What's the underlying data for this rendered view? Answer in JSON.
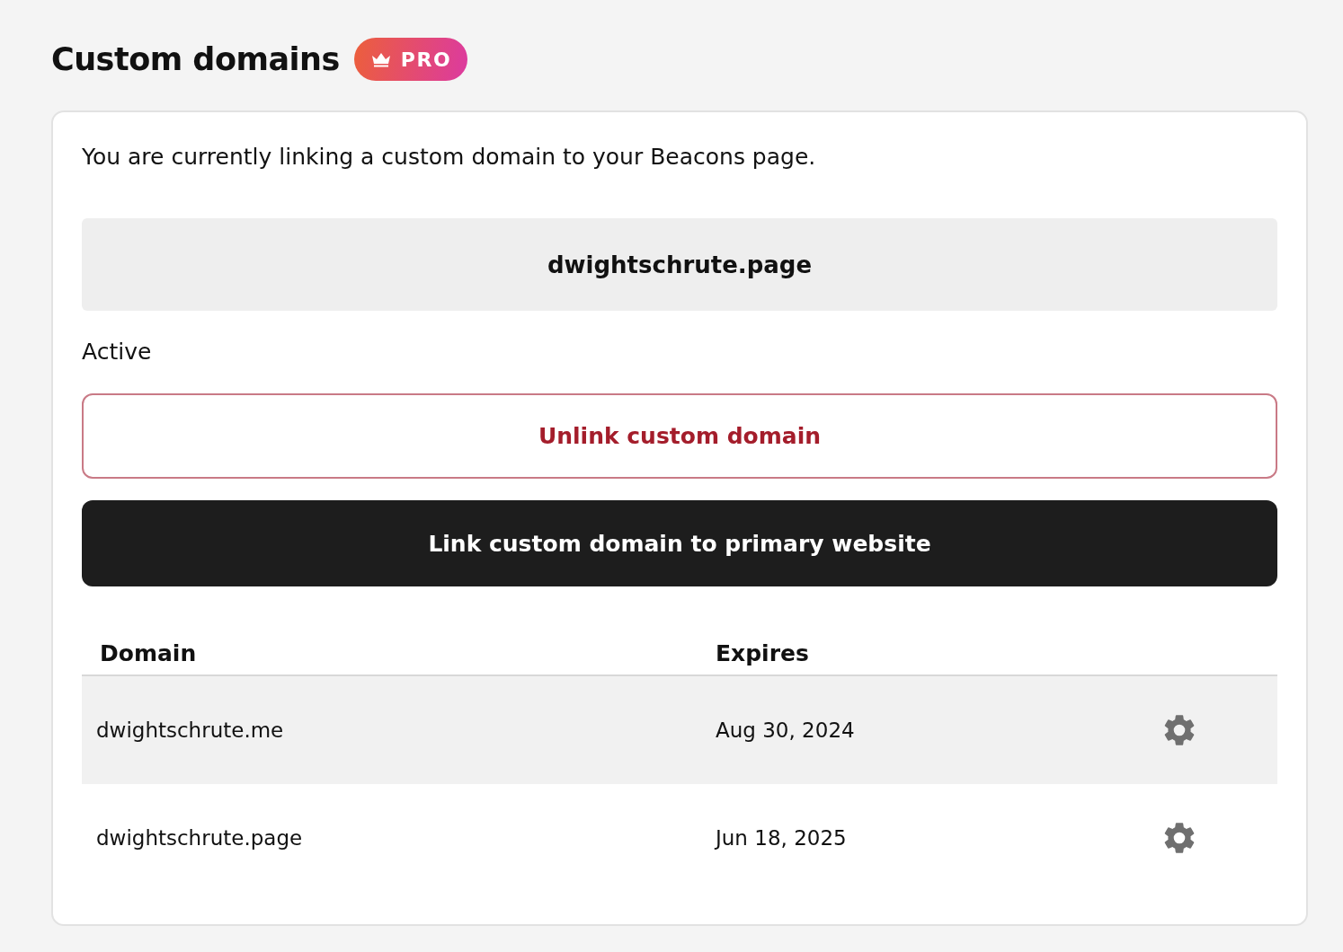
{
  "header": {
    "title": "Custom domains",
    "badge": "PRO"
  },
  "card": {
    "description": "You are currently linking a custom domain to your Beacons page.",
    "current_domain": "dwightschrute.page",
    "status": "Active",
    "unlink_button": "Unlink custom domain",
    "link_button": "Link custom domain to primary website"
  },
  "table": {
    "columns": [
      "Domain",
      "Expires"
    ],
    "rows": [
      {
        "domain": "dwightschrute.me",
        "expires": "Aug 30, 2024",
        "selected": true
      },
      {
        "domain": "dwightschrute.page",
        "expires": "Jun 18, 2025",
        "selected": false
      }
    ]
  }
}
